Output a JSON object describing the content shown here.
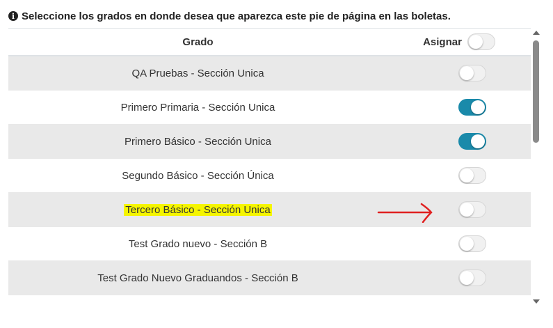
{
  "notice": {
    "icon": "info-icon",
    "text": "Seleccione los grados en donde desea que aparezca este pie de página en las boletas."
  },
  "table": {
    "headers": {
      "grado": "Grado",
      "asignar": "Asignar"
    },
    "assign_all": false,
    "rows": [
      {
        "grado": "QA Pruebas - Sección Unica",
        "assigned": false,
        "highlighted": false
      },
      {
        "grado": "Primero Primaria - Sección Unica",
        "assigned": true,
        "highlighted": false
      },
      {
        "grado": "Primero Básico - Sección Unica",
        "assigned": true,
        "highlighted": false
      },
      {
        "grado": "Segundo Básico - Sección Única",
        "assigned": false,
        "highlighted": false
      },
      {
        "grado": "Tercero Básico - Sección Unica",
        "assigned": false,
        "highlighted": true
      },
      {
        "grado": "Test Grado nuevo - Sección B",
        "assigned": false,
        "highlighted": false
      },
      {
        "grado": "Test Grado Nuevo Graduandos - Sección B",
        "assigned": false,
        "highlighted": false
      }
    ]
  },
  "colors": {
    "toggle_on": "#1a8aaa",
    "highlight": "#f5f500",
    "annotation_arrow": "#e02020"
  }
}
